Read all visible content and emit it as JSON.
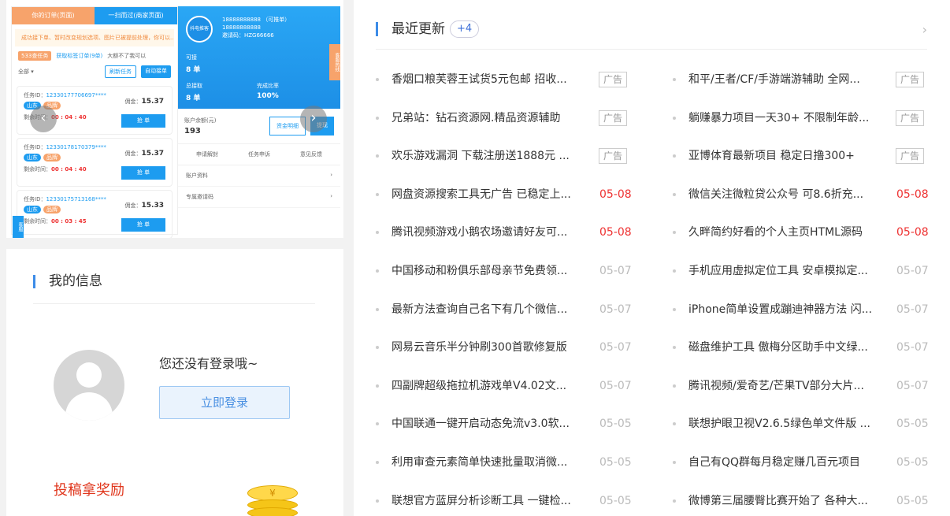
{
  "banner": {
    "tabs": [
      "你的订单(页面)",
      "一扫而过(商家页面)"
    ],
    "notice": "成功接下单、暂时改变规划选项、图片已被提前处理，你可以...",
    "filters": {
      "tag": "533查任务",
      "link": "获取标签订单(9单)",
      "gray": "大额不了我可以"
    },
    "bar": {
      "left": "全部 ▾",
      "refresh": "刷新任务",
      "auto": "自动接单"
    },
    "tasks": [
      {
        "id_label": "任务ID：",
        "id": "12330177706697****",
        "tag1": "山东",
        "tag2": "品牌",
        "money_label": "佣金：",
        "money": "15.37",
        "time_label": "剩余时间：",
        "time": "00 : 04 : 40",
        "btn": "抢 单"
      },
      {
        "id_label": "任务ID：",
        "id": "12330178170379****",
        "tag1": "山东",
        "tag2": "品牌",
        "money_label": "佣金：",
        "money": "15.37",
        "time_label": "剩余时间：",
        "time": "00 : 04 : 40",
        "btn": "抢 单"
      },
      {
        "id_label": "任务ID：",
        "id": "12330175713168****",
        "tag1": "山东",
        "tag2": "品牌",
        "money_label": "佣金：",
        "money": "15.33",
        "time_label": "剩余时间：",
        "time": "00 : 03 : 45",
        "btn": "抢 单"
      }
    ],
    "profile": {
      "logo": "抖电推客",
      "phone1": "18888888888 （可推单）",
      "phone2": "18888888888",
      "code": "邀请码：HZG66666",
      "stat1_label": "可接",
      "stat1_value": "8 单",
      "stat2_label": "总接取",
      "stat2_value": "8 单",
      "stat3_label": "完成比率",
      "stat3_value": "100%",
      "side": "客服热线"
    },
    "balance": {
      "label": "账户余额(元)",
      "value": "193",
      "btn1": "资金明细",
      "btn2": "提现"
    },
    "menu": [
      "申请解封",
      "任务申诉",
      "意见反馈"
    ],
    "rows": [
      "账户资料",
      "专属邀请码"
    ],
    "side_tab": "客服"
  },
  "info": {
    "title": "我的信息",
    "not_login": "您还没有登录哦~",
    "login_btn": "立即登录",
    "contribute": "投稿拿奖励",
    "coin_symbol": "¥"
  },
  "news": {
    "title": "最近更新",
    "count": "+4",
    "more_icon": "›",
    "left": [
      {
        "title": "香烟口粮芙蓉王试货5元包邮 招收...",
        "tag": "广告",
        "is_ad": true
      },
      {
        "title": "兄弟站：钻石资源网.精品资源辅助",
        "tag": "广告",
        "is_ad": true
      },
      {
        "title": "欢乐游戏漏洞 下载注册送1888元 ...",
        "tag": "广告",
        "is_ad": true
      },
      {
        "title": "网盘资源搜索工具无广告 已稳定上...",
        "tag": "05-08",
        "is_ad": false,
        "recent": true
      },
      {
        "title": "腾讯视频游戏小鹅农场邀请好友可...",
        "tag": "05-08",
        "is_ad": false,
        "recent": true
      },
      {
        "title": "中国移动和粉俱乐部母亲节免费领...",
        "tag": "05-07",
        "is_ad": false,
        "recent": false
      },
      {
        "title": "最新方法查询自己名下有几个微信...",
        "tag": "05-07",
        "is_ad": false,
        "recent": false
      },
      {
        "title": "网易云音乐半分钟刷300首歌修复版",
        "tag": "05-07",
        "is_ad": false,
        "recent": false
      },
      {
        "title": "四副牌超级拖拉机游戏单V4.02文...",
        "tag": "05-07",
        "is_ad": false,
        "recent": false
      },
      {
        "title": "中国联通一键开启动态免流v3.0软...",
        "tag": "05-05",
        "is_ad": false,
        "recent": false
      },
      {
        "title": "利用审查元素简单快速批量取消微...",
        "tag": "05-05",
        "is_ad": false,
        "recent": false
      },
      {
        "title": "联想官方蓝屏分析诊断工具 一键检...",
        "tag": "05-05",
        "is_ad": false,
        "recent": false
      }
    ],
    "right": [
      {
        "title": "和平/王者/CF/手游端游辅助 全网...",
        "tag": "广告",
        "is_ad": true
      },
      {
        "title": "躺赚暴力项目一天30+ 不限制年龄...",
        "tag": "广告",
        "is_ad": true
      },
      {
        "title": "亚博体育最新项目 稳定日撸300+",
        "tag": "广告",
        "is_ad": true
      },
      {
        "title": "微信关注微粒贷公众号 可8.6折充...",
        "tag": "05-08",
        "is_ad": false,
        "recent": true
      },
      {
        "title": "久畔简约好看的个人主页HTML源码",
        "tag": "05-08",
        "is_ad": false,
        "recent": true
      },
      {
        "title": "手机应用虚拟定位工具 安卓模拟定...",
        "tag": "05-07",
        "is_ad": false,
        "recent": false
      },
      {
        "title": "iPhone简单设置成蹦迪神器方法 闪...",
        "tag": "05-07",
        "is_ad": false,
        "recent": false
      },
      {
        "title": "磁盘维护工具 傲梅分区助手中文绿...",
        "tag": "05-07",
        "is_ad": false,
        "recent": false
      },
      {
        "title": "腾讯视频/爱奇艺/芒果TV部分大片...",
        "tag": "05-07",
        "is_ad": false,
        "recent": false
      },
      {
        "title": "联想护眼卫视V2.6.5绿色单文件版 ...",
        "tag": "05-05",
        "is_ad": false,
        "recent": false
      },
      {
        "title": "自己有QQ群每月稳定赚几百元项目",
        "tag": "05-05",
        "is_ad": false,
        "recent": false
      },
      {
        "title": "微博第三届腰臀比赛开始了 各种大...",
        "tag": "05-05",
        "is_ad": false,
        "recent": false
      }
    ]
  }
}
